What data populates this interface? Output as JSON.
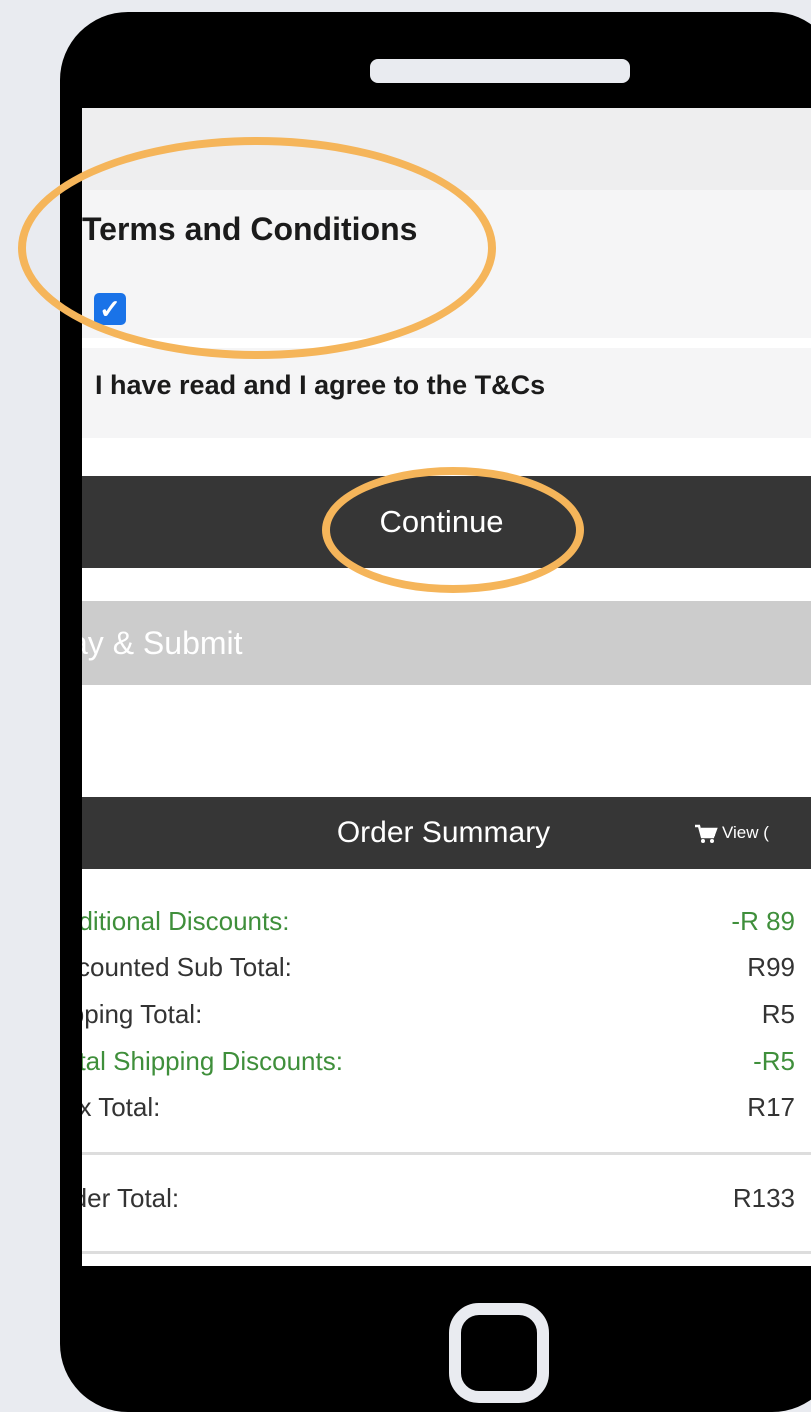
{
  "terms": {
    "title": "Terms and Conditions",
    "checkbox_checked": true,
    "agree_label": "I have read and I agree to the T&Cs"
  },
  "actions": {
    "continue_label": "Continue",
    "pay_submit_label": "ay & Submit"
  },
  "order_summary": {
    "title": "Order Summary",
    "view_cart_label": "View (",
    "rows": [
      {
        "label": "dditional Discounts:",
        "value": "-R 89"
      },
      {
        "label": "scounted Sub Total:",
        "value": "R99"
      },
      {
        "label": "ipping Total:",
        "value": "R5"
      },
      {
        "label": "otal Shipping Discounts:",
        "value": "-R5"
      },
      {
        "label": "ax Total:",
        "value": "R17"
      }
    ],
    "total": {
      "label": "rder Total:",
      "value": "R133"
    }
  },
  "colors": {
    "highlight_ring": "#f5b55a",
    "discount_green": "#3f8f3b",
    "bar_dark": "#363636",
    "checkbox_blue": "#1a73e8"
  },
  "icons": [
    "cart-icon",
    "checkmark-icon"
  ]
}
